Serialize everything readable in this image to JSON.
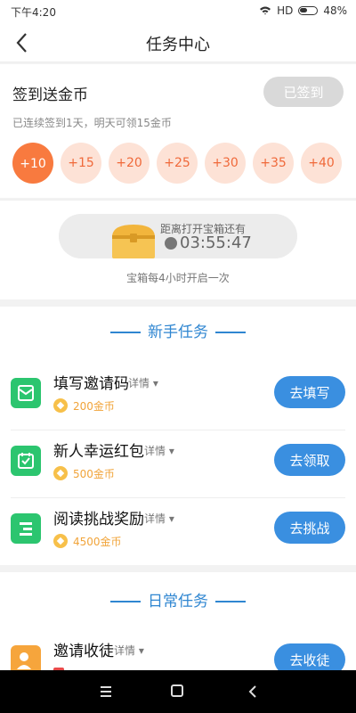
{
  "statusbar": {
    "time": "下午4:20",
    "network": "HD",
    "battery": "48%"
  },
  "header": {
    "title": "任务中心"
  },
  "checkin": {
    "title": "签到送金币",
    "button": "已签到",
    "subtitle": "已连续签到1天，明天可领15金币",
    "rewards": [
      "+10",
      "+15",
      "+20",
      "+25",
      "+30",
      "+35",
      "+40"
    ]
  },
  "chest": {
    "label": "距离打开宝箱还有",
    "countdown": "03:55:47",
    "note": "宝箱每4小时开启一次"
  },
  "newbie": {
    "title": "新手任务",
    "tasks": [
      {
        "name": "填写邀请码",
        "detail": "详情",
        "reward": "200金币",
        "button": "去填写"
      },
      {
        "name": "新人幸运红包",
        "detail": "详情",
        "reward": "500金币",
        "button": "去领取"
      },
      {
        "name": "阅读挑战奖励",
        "detail": "详情",
        "reward": "4500金币",
        "button": "去挑战"
      }
    ]
  },
  "daily": {
    "title": "日常任务",
    "tasks": [
      {
        "name": "邀请收徒",
        "detail": "详情",
        "button": "去收徒"
      }
    ]
  },
  "colors": {
    "accent_blue": "#3a8fe0",
    "accent_orange": "#f87a3f",
    "green_icon": "#2cc56f"
  }
}
